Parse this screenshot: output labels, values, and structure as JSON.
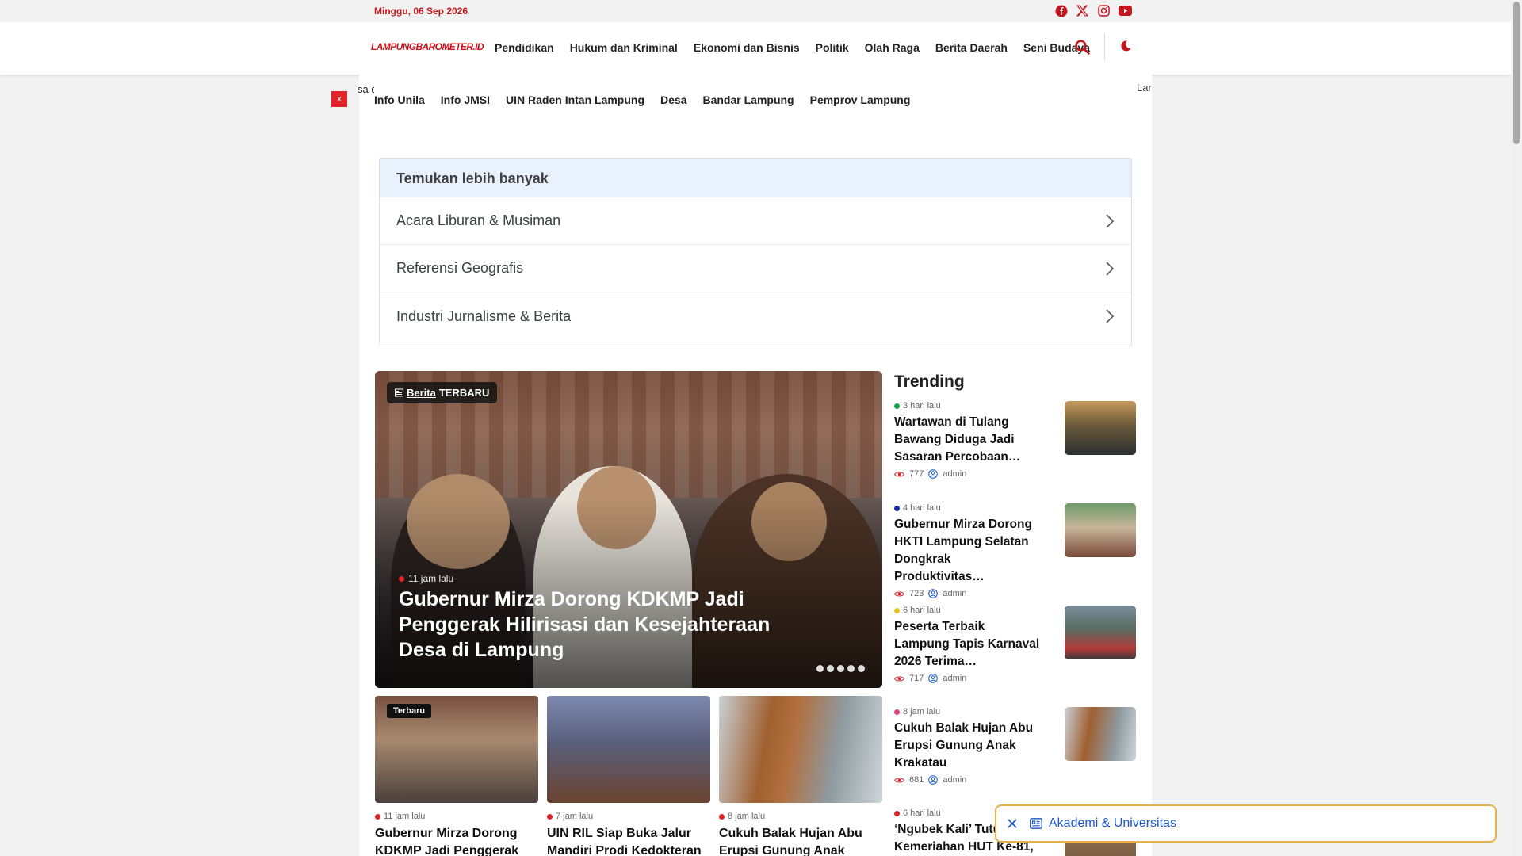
{
  "topbar": {
    "date": "Minggu, 06 Sep 2026"
  },
  "header": {
    "logo_text": "LAMPUNGBAROMETER.ID",
    "nav": [
      "Pendidikan",
      "Hukum dan Kriminal",
      "Ekonomi dan Bisnis",
      "Politik",
      "Olah Raga",
      "Berita Daerah",
      "Seni Budaya"
    ]
  },
  "ticker": {
    "left": "sa d",
    "right": "Lar",
    "close": "x"
  },
  "subnav": [
    "Info Unila",
    "Info JMSI",
    "UIN Raden Intan Lampung",
    "Desa",
    "Bandar Lampung",
    "Pemprov Lampung"
  ],
  "discover": {
    "heading": "Temukan lebih banyak",
    "items": [
      "Acara Liburan & Musiman",
      "Referensi Geografis",
      "Industri Jurnalisme & Berita"
    ]
  },
  "hero": {
    "badge_category": "Berita",
    "badge_label": "TERBARU",
    "time": "11 jam  lalu",
    "title": "Gubernur Mirza Dorong KDKMP Jadi Penggerak Hilirisasi dan Kesejahteraan Desa di Lampung"
  },
  "cards": [
    {
      "tag": "Terbaru",
      "time": "11 jam  lalu",
      "title": "Gubernur Mirza Dorong KDKMP Jadi Penggerak"
    },
    {
      "tag": "",
      "time": "7 jam  lalu",
      "title": "UIN RIL Siap Buka Jalur Mandiri Prodi Kedokteran"
    },
    {
      "tag": "",
      "time": "8 jam  lalu",
      "title": "Cukuh Balak Hujan Abu Erupsi Gunung Anak"
    }
  ],
  "trending": {
    "heading": "Trending",
    "items": [
      {
        "time": "3 hari  lalu",
        "dot": "#1aa34a",
        "title": "Wartawan di Tulang Bawang Diduga Jadi Sasaran Percobaan…",
        "views": "777",
        "author": "admin"
      },
      {
        "time": "4 hari  lalu",
        "dot": "#1b2fa8",
        "title": "Gubernur Mirza Dorong HKTI Lampung Selatan Dongkrak Produktivitas…",
        "views": "723",
        "author": "admin"
      },
      {
        "time": "6 hari  lalu",
        "dot": "#e8c31a",
        "title": "Peserta Terbaik Lampung Tapis Karnaval 2026 Terima…",
        "views": "717",
        "author": "admin"
      },
      {
        "time": "8 jam  lalu",
        "dot": "#e0457b",
        "title": "Cukuh Balak Hujan Abu Erupsi Gunung Anak Krakatau",
        "views": "681",
        "author": "admin"
      },
      {
        "time": "6 hari  lalu",
        "dot": "#e0252a",
        "title": "‘Ngubek Kali’ Tutu Kemeriahan HUT Ke-81,",
        "views": "",
        "author": ""
      }
    ]
  },
  "topic_bar": {
    "label": "Akademi & Universitas"
  }
}
